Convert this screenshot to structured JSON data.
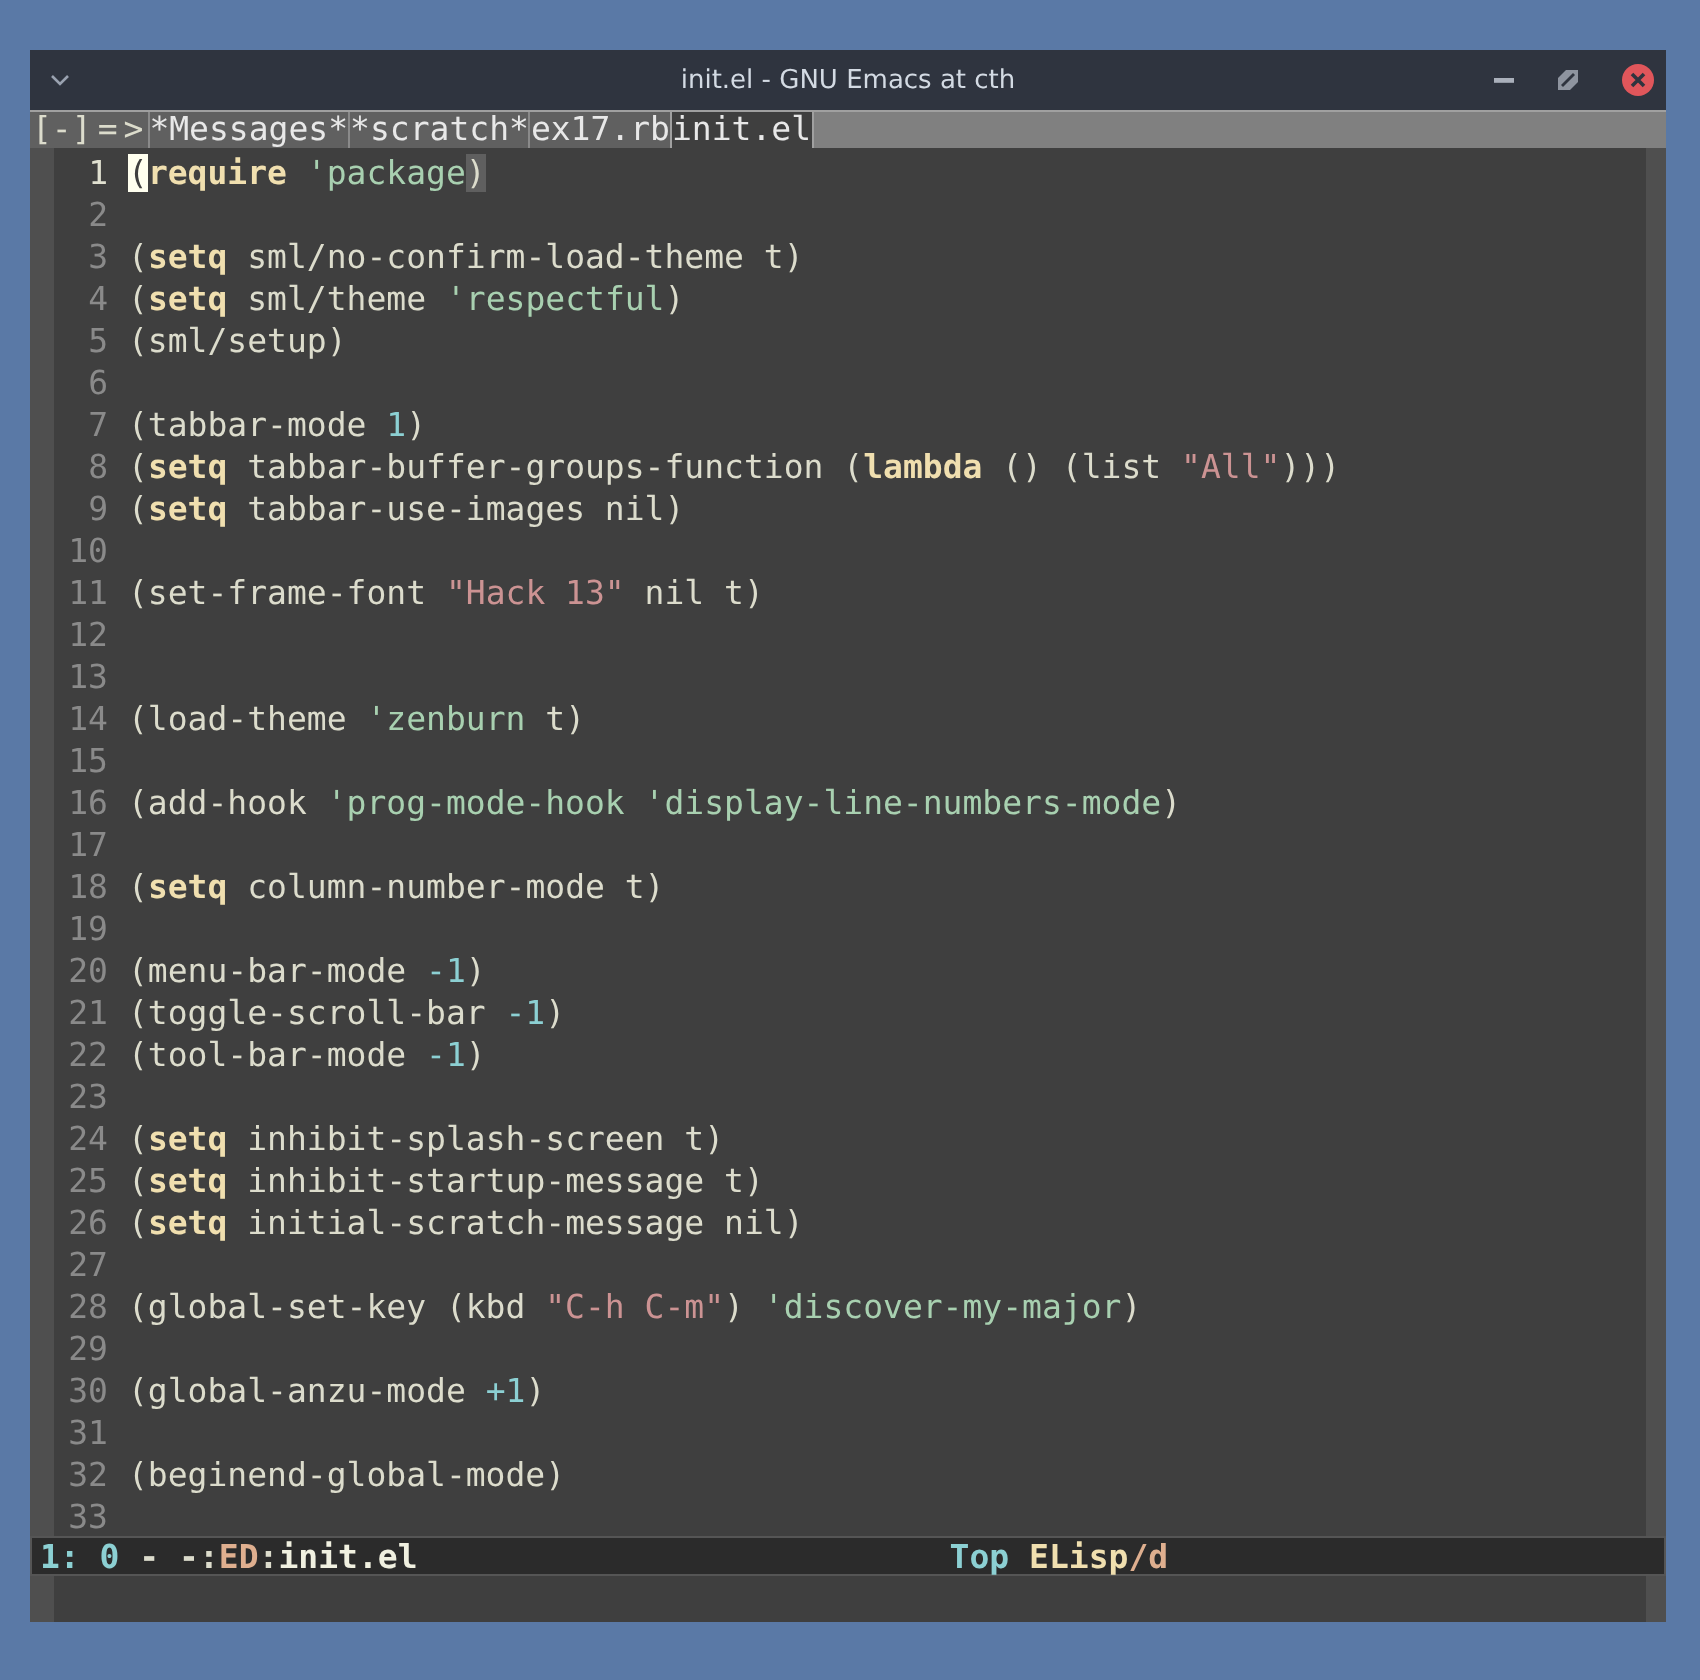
{
  "window": {
    "title": "init.el - GNU Emacs at cth"
  },
  "tabbar": {
    "controls": [
      "[-]",
      "=",
      ">"
    ],
    "tabs": [
      {
        "label": "*Messages*",
        "selected": false
      },
      {
        "label": "*scratch*",
        "selected": false
      },
      {
        "label": "ex17.rb",
        "selected": false
      },
      {
        "label": "init.el",
        "selected": true
      }
    ]
  },
  "lines": [
    {
      "number": "1",
      "current": true,
      "tokens": [
        {
          "kind": "cursor",
          "text": "("
        },
        {
          "kind": "kw",
          "text": "require"
        },
        {
          "kind": "sym",
          "text": " 'package"
        },
        {
          "kind": "match",
          "text": ")"
        }
      ]
    },
    {
      "number": "2",
      "current": false
    },
    {
      "number": "3",
      "current": false,
      "tokens": [
        {
          "kind": "plain",
          "text": "("
        },
        {
          "kind": "kw",
          "text": "setq"
        },
        {
          "kind": "plain",
          "text": " sml/no-confirm-load-theme t)"
        }
      ]
    },
    {
      "number": "4",
      "current": false,
      "tokens": [
        {
          "kind": "plain",
          "text": "("
        },
        {
          "kind": "kw",
          "text": "setq"
        },
        {
          "kind": "plain",
          "text": " sml/theme "
        },
        {
          "kind": "sym",
          "text": "'respectful"
        },
        {
          "kind": "plain",
          "text": ")"
        }
      ]
    },
    {
      "number": "5",
      "current": false,
      "tokens": [
        {
          "kind": "plain",
          "text": "(sml/setup)"
        }
      ]
    },
    {
      "number": "6",
      "current": false
    },
    {
      "number": "7",
      "current": false,
      "tokens": [
        {
          "kind": "plain",
          "text": "(tabbar-mode "
        },
        {
          "kind": "num",
          "text": "1"
        },
        {
          "kind": "plain",
          "text": ")"
        }
      ]
    },
    {
      "number": "8",
      "current": false,
      "tokens": [
        {
          "kind": "plain",
          "text": "("
        },
        {
          "kind": "kw",
          "text": "setq"
        },
        {
          "kind": "plain",
          "text": " tabbar-buffer-groups-function ("
        },
        {
          "kind": "kw",
          "text": "lambda"
        },
        {
          "kind": "plain",
          "text": " () (list "
        },
        {
          "kind": "str",
          "text": "\"All\""
        },
        {
          "kind": "plain",
          "text": ")))"
        }
      ]
    },
    {
      "number": "9",
      "current": false,
      "tokens": [
        {
          "kind": "plain",
          "text": "("
        },
        {
          "kind": "kw",
          "text": "setq"
        },
        {
          "kind": "plain",
          "text": " tabbar-use-images nil)"
        }
      ]
    },
    {
      "number": "10",
      "current": false
    },
    {
      "number": "11",
      "current": false,
      "tokens": [
        {
          "kind": "plain",
          "text": "(set-frame-font "
        },
        {
          "kind": "str",
          "text": "\"Hack 13\""
        },
        {
          "kind": "plain",
          "text": " nil t)"
        }
      ]
    },
    {
      "number": "12",
      "current": false
    },
    {
      "number": "13",
      "current": false
    },
    {
      "number": "14",
      "current": false,
      "tokens": [
        {
          "kind": "plain",
          "text": "(load-theme "
        },
        {
          "kind": "sym",
          "text": "'zenburn"
        },
        {
          "kind": "plain",
          "text": " t)"
        }
      ]
    },
    {
      "number": "15",
      "current": false
    },
    {
      "number": "16",
      "current": false,
      "tokens": [
        {
          "kind": "plain",
          "text": "(add-hook "
        },
        {
          "kind": "sym",
          "text": "'prog-mode-hook"
        },
        {
          "kind": "sym",
          "text": " 'display-line-numbers-mode"
        },
        {
          "kind": "plain",
          "text": ")"
        }
      ]
    },
    {
      "number": "17",
      "current": false
    },
    {
      "number": "18",
      "current": false,
      "tokens": [
        {
          "kind": "plain",
          "text": "("
        },
        {
          "kind": "kw",
          "text": "setq"
        },
        {
          "kind": "plain",
          "text": " column-number-mode t)"
        }
      ]
    },
    {
      "number": "19",
      "current": false
    },
    {
      "number": "20",
      "current": false,
      "tokens": [
        {
          "kind": "plain",
          "text": "(menu-bar-mode "
        },
        {
          "kind": "num",
          "text": "-1"
        },
        {
          "kind": "plain",
          "text": ")"
        }
      ]
    },
    {
      "number": "21",
      "current": false,
      "tokens": [
        {
          "kind": "plain",
          "text": "(toggle-scroll-bar "
        },
        {
          "kind": "num",
          "text": "-1"
        },
        {
          "kind": "plain",
          "text": ")"
        }
      ]
    },
    {
      "number": "22",
      "current": false,
      "tokens": [
        {
          "kind": "plain",
          "text": "(tool-bar-mode "
        },
        {
          "kind": "num",
          "text": "-1"
        },
        {
          "kind": "plain",
          "text": ")"
        }
      ]
    },
    {
      "number": "23",
      "current": false
    },
    {
      "number": "24",
      "current": false,
      "tokens": [
        {
          "kind": "plain",
          "text": "("
        },
        {
          "kind": "kw",
          "text": "setq"
        },
        {
          "kind": "plain",
          "text": " inhibit-splash-screen t)"
        }
      ]
    },
    {
      "number": "25",
      "current": false,
      "tokens": [
        {
          "kind": "plain",
          "text": "("
        },
        {
          "kind": "kw",
          "text": "setq"
        },
        {
          "kind": "plain",
          "text": " inhibit-startup-message t)"
        }
      ]
    },
    {
      "number": "26",
      "current": false,
      "tokens": [
        {
          "kind": "plain",
          "text": "("
        },
        {
          "kind": "kw",
          "text": "setq"
        },
        {
          "kind": "plain",
          "text": " initial-scratch-message nil)"
        }
      ]
    },
    {
      "number": "27",
      "current": false
    },
    {
      "number": "28",
      "current": false,
      "tokens": [
        {
          "kind": "plain",
          "text": "(global-set-key (kbd "
        },
        {
          "kind": "str",
          "text": "\"C-h C-m\""
        },
        {
          "kind": "plain",
          "text": ") "
        },
        {
          "kind": "sym",
          "text": "'discover-my-major"
        },
        {
          "kind": "plain",
          "text": ")"
        }
      ]
    },
    {
      "number": "29",
      "current": false
    },
    {
      "number": "30",
      "current": false,
      "tokens": [
        {
          "kind": "plain",
          "text": "(global-anzu-mode "
        },
        {
          "kind": "num",
          "text": "+1"
        },
        {
          "kind": "plain",
          "text": ")"
        }
      ]
    },
    {
      "number": "31",
      "current": false
    },
    {
      "number": "32",
      "current": false,
      "tokens": [
        {
          "kind": "plain",
          "text": "(beginend-global-mode)"
        }
      ]
    },
    {
      "number": "33",
      "current": false
    }
  ],
  "mode_line": {
    "left": [
      {
        "kind": "num",
        "text": "1: 0"
      },
      {
        "kind": "plain",
        "text": " - -:"
      },
      {
        "kind": "orange",
        "text": "ED"
      },
      {
        "kind": "plain",
        "text": ":"
      },
      {
        "kind": "boldw",
        "text": "init.el"
      }
    ],
    "right": [
      {
        "kind": "num",
        "text": "Top "
      },
      {
        "kind": "kw",
        "text": "ELisp"
      },
      {
        "kind": "orange",
        "text": "/d"
      }
    ]
  }
}
